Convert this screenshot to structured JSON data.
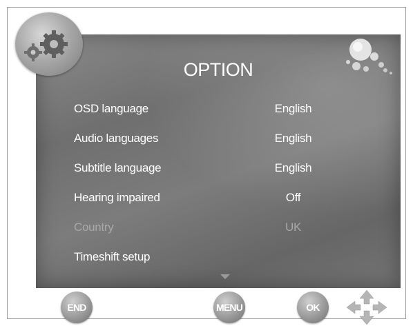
{
  "menu": {
    "title": "OPTION",
    "items": [
      {
        "label": "OSD language",
        "value": "English",
        "enabled": true
      },
      {
        "label": "Audio languages",
        "value": "English",
        "enabled": true
      },
      {
        "label": "Subtitle language",
        "value": "English",
        "enabled": true
      },
      {
        "label": "Hearing impaired",
        "value": "Off",
        "enabled": true
      },
      {
        "label": "Country",
        "value": "UK",
        "enabled": false
      },
      {
        "label": "Timeshift setup",
        "value": "",
        "enabled": true
      }
    ]
  },
  "buttons": {
    "end_label": "END",
    "menu_label": "MENU",
    "ok_label": "OK"
  },
  "icons": {
    "badge": "gear-icon",
    "decoration": "bubbles-icon",
    "scroll": "chevron-down-icon",
    "navigation": "four-way-arrows-icon"
  },
  "colors": {
    "text": "#ffffff",
    "disabled_text": "#a8a8a8",
    "panel": "#7a7a7a"
  }
}
